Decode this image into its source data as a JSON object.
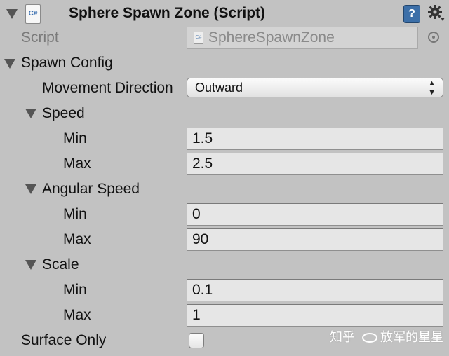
{
  "header": {
    "title": "Sphere Spawn Zone (Script)",
    "script_icon_text": "C#",
    "help_icon_text": "?"
  },
  "script": {
    "label": "Script",
    "value": "SphereSpawnZone"
  },
  "spawn_config": {
    "label": "Spawn Config",
    "movement_direction": {
      "label": "Movement Direction",
      "value": "Outward"
    },
    "speed": {
      "label": "Speed",
      "min_label": "Min",
      "min_value": "1.5",
      "max_label": "Max",
      "max_value": "2.5"
    },
    "angular_speed": {
      "label": "Angular Speed",
      "min_label": "Min",
      "min_value": "0",
      "max_label": "Max",
      "max_value": "90"
    },
    "scale": {
      "label": "Scale",
      "min_label": "Min",
      "min_value": "0.1",
      "max_label": "Max",
      "max_value": "1"
    }
  },
  "surface_only": {
    "label": "Surface Only",
    "checked": false
  },
  "watermark": {
    "text": "知乎",
    "handle": "放军的星星"
  },
  "colors": {
    "background": "#c2c2c2",
    "field_bg": "#e6e6e6",
    "help_icon": "#3c6fa8"
  }
}
